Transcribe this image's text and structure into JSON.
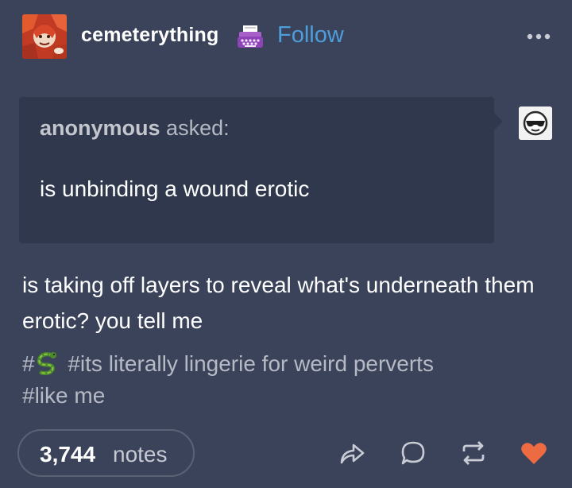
{
  "post": {
    "username": "cemeterything",
    "follow_label": "Follow",
    "asker_name": "anonymous",
    "asked_label": "asked:",
    "question": "is unbinding a wound erotic",
    "answer": "is taking off layers to reveal what's underneath them erotic? you tell me",
    "tags": {
      "tag1_prefix": "#",
      "tag2": "#its literally lingerie for weird perverts",
      "tag3": "#like me"
    },
    "notes_count": "3,744",
    "notes_label": "notes"
  },
  "icons": {
    "avatar": "red-illustrated-avatar",
    "badge": "typewriter-icon",
    "more": "more-dots-icon",
    "anon": "sunglasses-face-icon",
    "tag_emoji": "snake-icon",
    "share": "share-icon",
    "reply": "reply-icon",
    "reblog": "reblog-icon",
    "like": "heart-icon"
  },
  "colors": {
    "background": "#3a4359",
    "ask_box": "#2f384c",
    "follow": "#4e9ddb",
    "tag_text": "#b6bac4",
    "heart": "#ec6b43"
  }
}
